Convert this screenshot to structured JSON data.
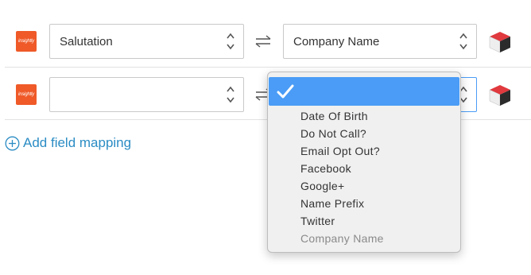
{
  "mappings": [
    {
      "source_logo_text": "insightly",
      "source_value": "Salutation",
      "target_value": "Company Name"
    },
    {
      "source_logo_text": "insightly",
      "source_value": "",
      "target_value": ""
    }
  ],
  "add_mapping_label": "Add field mapping",
  "dropdown": {
    "selected_label": "",
    "options": [
      "Date Of Birth",
      "Do Not Call?",
      "Email Opt Out?",
      "Facebook",
      "Google+",
      "Name Prefix",
      "Twitter"
    ],
    "disabled_option": "Company Name"
  },
  "colors": {
    "accent": "#2b8cc4",
    "logo": "#ef5a28",
    "selection": "#4a9cf6"
  },
  "icons": {
    "swap": "swap-arrows-icon",
    "crm": "crm-cube-icon",
    "add": "plus-circle-icon",
    "check": "checkmark-icon"
  }
}
